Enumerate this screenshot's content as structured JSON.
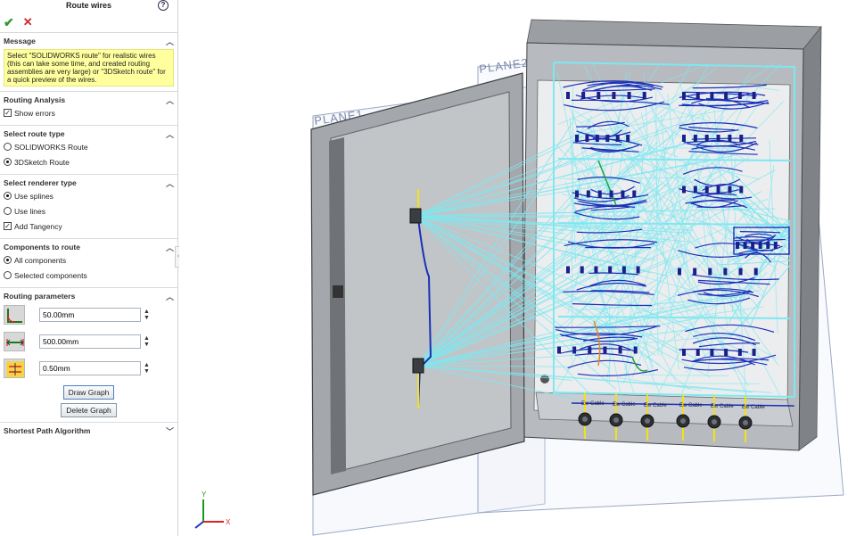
{
  "panel": {
    "title": "Route wires",
    "help_icon": "question-circle-icon",
    "ok_icon": "checkmark-icon",
    "cancel_icon": "x-icon",
    "message": {
      "header": "Message",
      "text": "Select \"SOLIDWORKS route\" for realistic wires (this can take some time, and created routing assemblies are very large) or \"3DSketch route\" for a quick preview of the wires."
    },
    "routing_analysis": {
      "header": "Routing Analysis",
      "show_errors": {
        "label": "Show errors",
        "checked": true
      }
    },
    "route_type": {
      "header": "Select route type",
      "options": [
        {
          "label": "SOLIDWORKS Route",
          "selected": false
        },
        {
          "label": "3DSketch Route",
          "selected": true
        }
      ]
    },
    "renderer_type": {
      "header": "Select renderer type",
      "options": [
        {
          "label": "Use splines",
          "selected": true
        },
        {
          "label": "Use lines",
          "selected": false
        }
      ],
      "add_tangency": {
        "label": "Add Tangency",
        "checked": true
      }
    },
    "components": {
      "header": "Components to route",
      "options": [
        {
          "label": "All components",
          "selected": true
        },
        {
          "label": "Selected components",
          "selected": false
        }
      ]
    },
    "routing_parameters": {
      "header": "Routing parameters",
      "fields": [
        {
          "icon": "bend-radius-icon",
          "value": "50.00mm"
        },
        {
          "icon": "length-offset-icon",
          "value": "500.00mm"
        },
        {
          "icon": "wire-spacing-icon",
          "value": "0.50mm"
        }
      ],
      "draw_graph": "Draw Graph",
      "delete_graph": "Delete Graph"
    },
    "shortest_path": {
      "header": "Shortest Path Algorithm"
    }
  },
  "viewport": {
    "planes": [
      "PLANE1",
      "PLANE2"
    ],
    "cable_labels": [
      "Ew Cable",
      "Ew Cable",
      "Ew Cable",
      "Ew Cable",
      "Ew Cable",
      "Ew Cable"
    ],
    "triad": {
      "x": "X",
      "y": "Y"
    },
    "colors": {
      "wire": "#7ee8f0",
      "routes": "#1a2fb8",
      "cabinet": "#8d9196",
      "door": "#a9adb2",
      "plane": "#9aa7c6"
    }
  }
}
